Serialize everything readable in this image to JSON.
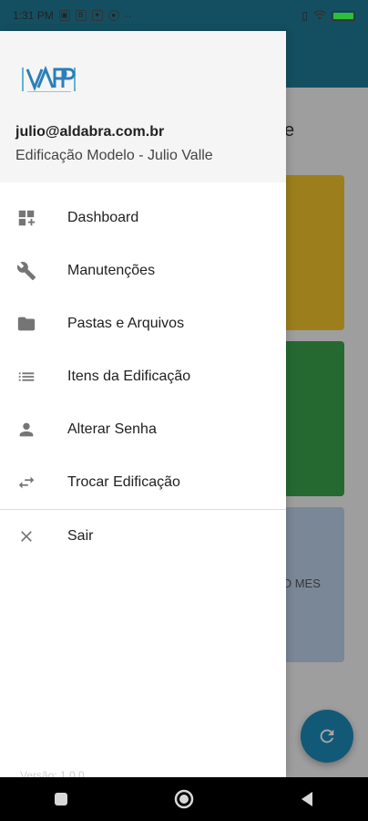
{
  "status_bar": {
    "time": "1:31 PM",
    "notification_icons": [
      "photo-icon",
      "bbc-icon",
      "app-icon",
      "circle-icon",
      "more-icon"
    ],
    "right_icons": [
      "vibrate-icon",
      "wifi-icon",
      "battery-icon"
    ],
    "battery_level": 1.0
  },
  "background": {
    "title_fragment": "e",
    "card_text": "O MES"
  },
  "drawer": {
    "logo_name": "VAPP",
    "account": {
      "email": "julio@aldabra.com.br",
      "name": "Edificação Modelo - Julio Valle"
    },
    "items": [
      {
        "label": "Dashboard",
        "icon": "dashboard-icon"
      },
      {
        "label": "Manutenções",
        "icon": "wrench-icon"
      },
      {
        "label": "Pastas e Arquivos",
        "icon": "folder-icon"
      },
      {
        "label": "Itens da Edificação",
        "icon": "list-icon"
      },
      {
        "label": "Alterar Senha",
        "icon": "person-icon"
      },
      {
        "label": "Trocar Edificação",
        "icon": "swap-icon"
      }
    ],
    "logout": {
      "label": "Sair",
      "icon": "close-icon"
    },
    "version": "Versão: 1.0.0"
  },
  "colors": {
    "appbar": "#1f7a96",
    "card_yellow": "#f0c22d",
    "card_green": "#3aa14a",
    "card_blue": "#bcd0e6",
    "fab": "#1d89b7"
  }
}
